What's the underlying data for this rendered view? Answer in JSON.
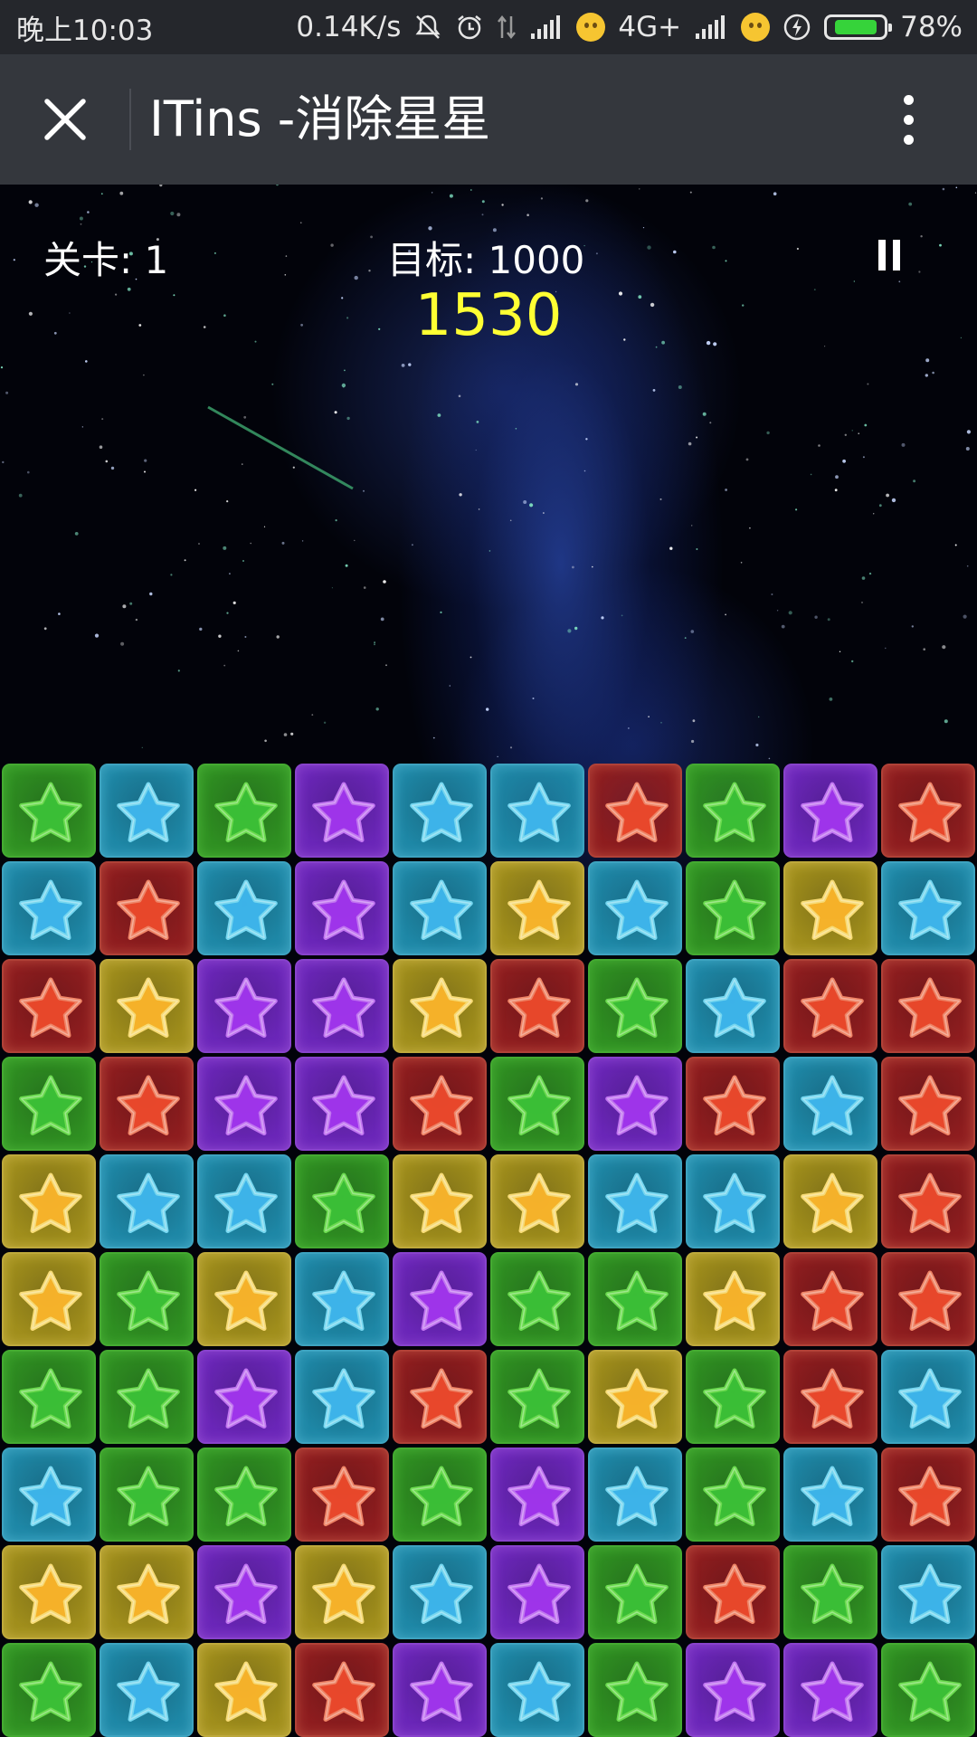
{
  "status_bar": {
    "time": "晚上10:03",
    "net_speed": "0.14K/s",
    "network": "4G+",
    "battery_percent": "78%",
    "battery_level": 0.78,
    "icons": [
      "mute-icon",
      "alarm-icon",
      "data-arrows-icon",
      "signal-icon",
      "emoji-face-icon",
      "signal-icon",
      "thinking-face-icon",
      "charging-icon",
      "battery-icon"
    ]
  },
  "title_bar": {
    "title": "ITins -消除星星",
    "close_icon": "close-icon",
    "more_icon": "more-vertical-icon"
  },
  "hud": {
    "level_label": "关卡: 1",
    "target_label": "目标: 1000",
    "score": "1530",
    "pause_icon": "pause-icon"
  },
  "colors": {
    "green": {
      "bg": "#2f8f22",
      "star": "#3cc238",
      "edge": "#6fe052"
    },
    "blue": {
      "bg": "#1e87a6",
      "star": "#3fb7ee",
      "edge": "#7adcf5"
    },
    "purple": {
      "bg": "#6a26b8",
      "star": "#a236ee",
      "edge": "#c77af5"
    },
    "red": {
      "bg": "#8e1d1f",
      "star": "#ee4a2c",
      "edge": "#f58a6a"
    },
    "yellow": {
      "bg": "#a08e1c",
      "star": "#fbb52b",
      "edge": "#fde07a"
    }
  },
  "board": {
    "rows": 10,
    "cols": 10,
    "grid": [
      [
        "G",
        "B",
        "G",
        "P",
        "B",
        "B",
        "R",
        "G",
        "P",
        "R"
      ],
      [
        "B",
        "R",
        "B",
        "P",
        "B",
        "Y",
        "B",
        "G",
        "Y",
        "B"
      ],
      [
        "R",
        "Y",
        "P",
        "P",
        "Y",
        "R",
        "G",
        "B",
        "R",
        "R"
      ],
      [
        "G",
        "R",
        "P",
        "P",
        "R",
        "G",
        "P",
        "R",
        "B",
        "R"
      ],
      [
        "Y",
        "B",
        "B",
        "G",
        "Y",
        "Y",
        "B",
        "B",
        "Y",
        "R"
      ],
      [
        "Y",
        "G",
        "Y",
        "B",
        "P",
        "G",
        "G",
        "Y",
        "R",
        "R"
      ],
      [
        "G",
        "G",
        "P",
        "B",
        "R",
        "G",
        "Y",
        "G",
        "R",
        "B"
      ],
      [
        "B",
        "G",
        "G",
        "R",
        "G",
        "P",
        "B",
        "G",
        "B",
        "R"
      ],
      [
        "Y",
        "Y",
        "P",
        "Y",
        "B",
        "P",
        "G",
        "R",
        "G",
        "B"
      ],
      [
        "G",
        "B",
        "Y",
        "R",
        "P",
        "B",
        "G",
        "P",
        "P",
        "G"
      ]
    ]
  }
}
